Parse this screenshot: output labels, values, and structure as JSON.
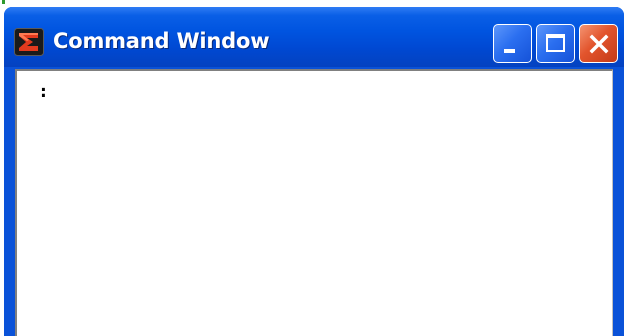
{
  "window": {
    "title": "Command Window",
    "app_icon": "sigma-app-icon",
    "controls": {
      "minimize": "minimize-icon",
      "maximize": "maximize-icon",
      "close": "close-icon"
    }
  },
  "console": {
    "prompt": ":"
  },
  "colors": {
    "titlebar": "#0054e0",
    "close_button": "#e2542c",
    "client_background": "#ffffff"
  }
}
